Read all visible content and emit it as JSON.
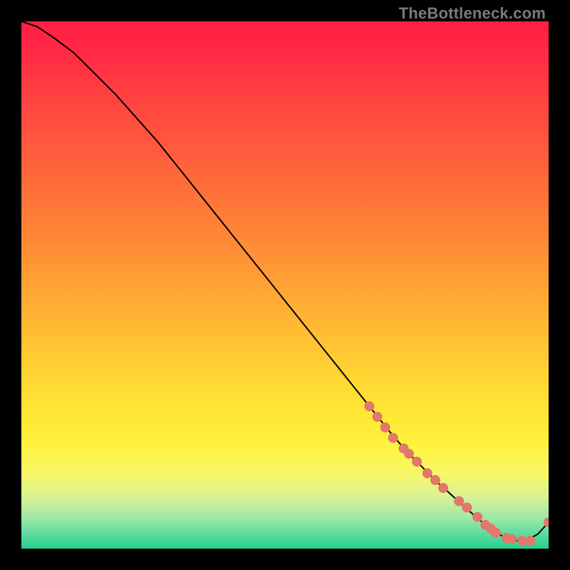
{
  "watermark": "TheBottleneck.com",
  "gradient_stops": [
    {
      "offset": 0.0,
      "color": "#ff1f44"
    },
    {
      "offset": 0.06,
      "color": "#ff2a44"
    },
    {
      "offset": 0.18,
      "color": "#ff4b3f"
    },
    {
      "offset": 0.3,
      "color": "#ff6a3a"
    },
    {
      "offset": 0.42,
      "color": "#ff8b36"
    },
    {
      "offset": 0.54,
      "color": "#ffae33"
    },
    {
      "offset": 0.66,
      "color": "#ffd232"
    },
    {
      "offset": 0.74,
      "color": "#ffe634"
    },
    {
      "offset": 0.8,
      "color": "#fff23b"
    },
    {
      "offset": 0.86,
      "color": "#f8f76a"
    },
    {
      "offset": 0.9,
      "color": "#d9f293"
    },
    {
      "offset": 0.94,
      "color": "#a3e8a8"
    },
    {
      "offset": 0.97,
      "color": "#62dca0"
    },
    {
      "offset": 1.0,
      "color": "#27cf8f"
    }
  ],
  "marker_color": "#e2776b",
  "marker_radius": 7,
  "line_color": "#000000",
  "chart_data": {
    "type": "line",
    "title": "",
    "xlabel": "",
    "ylabel": "",
    "xlim": [
      0,
      100
    ],
    "ylim": [
      0,
      100
    ],
    "series": [
      {
        "name": "curve",
        "x": [
          0,
          3,
          6,
          10,
          14,
          18,
          22,
          26,
          30,
          34,
          38,
          42,
          46,
          50,
          54,
          58,
          62,
          66,
          70,
          73,
          76,
          79,
          82,
          84,
          86,
          88,
          90,
          92,
          94,
          96,
          98,
          100
        ],
        "y": [
          100,
          99,
          97,
          94,
          90,
          86,
          81.5,
          77,
          72,
          67,
          62,
          57,
          52,
          47,
          42,
          37,
          32,
          27,
          22,
          18.5,
          15.5,
          12.5,
          9.8,
          8.0,
          6.2,
          4.5,
          3.0,
          2.0,
          1.5,
          1.6,
          2.8,
          5.0
        ]
      },
      {
        "name": "markers",
        "x": [
          66.0,
          67.5,
          69.0,
          70.5,
          72.5,
          73.5,
          75.0,
          77.0,
          78.5,
          80.0,
          83.0,
          84.5,
          86.5,
          88.0,
          89.0,
          90.0,
          92.0,
          93.0,
          95.0,
          96.5,
          100.0
        ],
        "y": [
          27.0,
          25.0,
          23.0,
          21.0,
          19.0,
          18.0,
          16.5,
          14.3,
          13.0,
          11.5,
          9.0,
          7.8,
          6.0,
          4.5,
          3.8,
          3.0,
          2.0,
          1.8,
          1.5,
          1.5,
          5.0
        ]
      }
    ]
  }
}
